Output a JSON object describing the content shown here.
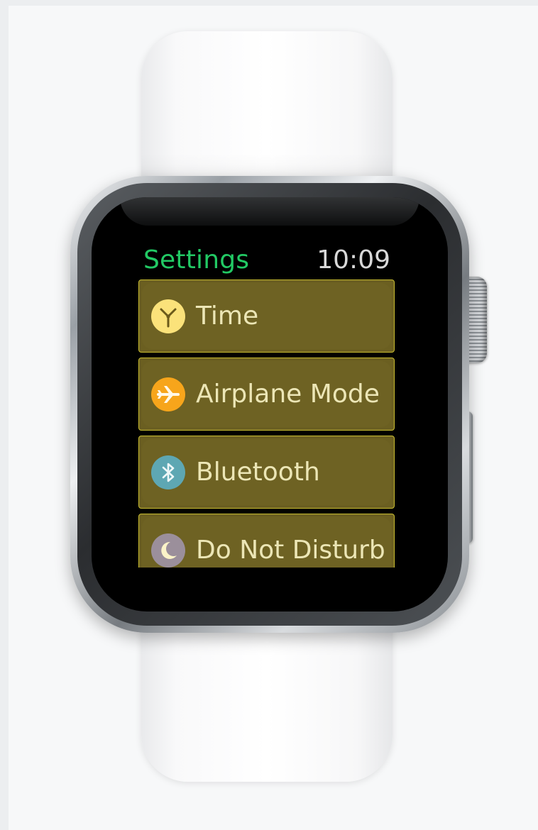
{
  "status_bar": {
    "app_title": "Settings",
    "time": "10:09"
  },
  "settings_list": {
    "items": [
      {
        "label": "Time",
        "icon": "clock-icon",
        "icon_color": "#fbe27a"
      },
      {
        "label": "Airplane Mode",
        "icon": "airplane-icon",
        "icon_color": "#f7a51b"
      },
      {
        "label": "Bluetooth",
        "icon": "bluetooth-icon",
        "icon_color": "#5ea7b3"
      },
      {
        "label": "Do Not Disturb",
        "icon": "moon-icon",
        "icon_color": "#9b8f9b"
      }
    ]
  },
  "colors": {
    "title_green": "#22c964",
    "item_background": "#6b5f21",
    "item_border": "#c9bd30",
    "item_text": "#ece6b6",
    "screen": "#000000"
  }
}
